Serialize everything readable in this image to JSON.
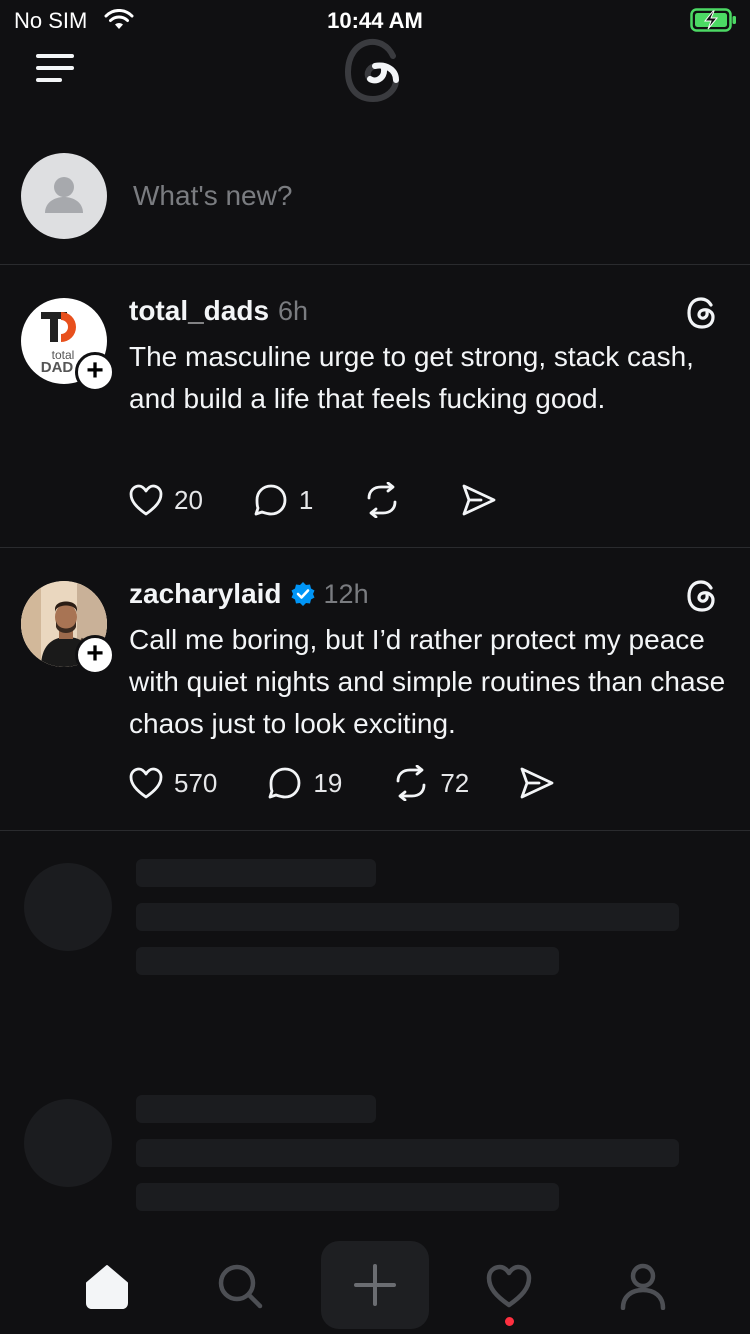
{
  "status_bar": {
    "carrier": "No SIM",
    "time": "10:44 AM",
    "battery_color": "#4cd964"
  },
  "composer": {
    "placeholder": "What's new?"
  },
  "posts": [
    {
      "username": "total_dads",
      "ago": "6h",
      "verified": false,
      "avatar_text_top": "total",
      "avatar_text_bottom": "DAD",
      "text": "The masculine urge to get strong, stack cash, and build a life that feels fucking good.",
      "likes": "20",
      "replies": "1",
      "reposts": ""
    },
    {
      "username": "zacharylaid",
      "ago": "12h",
      "verified": true,
      "text": "Call me boring, but I’d rather protect my peace with quiet nights and simple routines than chase chaos just to look exciting.",
      "likes": "570",
      "replies": "19",
      "reposts": "72"
    }
  ],
  "colors": {
    "accent_verified": "#0095f6",
    "notif_dot": "#ff3040",
    "background": "#101012"
  },
  "tab_bar": {
    "items": [
      "home-icon",
      "search-icon",
      "create-icon",
      "activity-icon",
      "profile-icon"
    ],
    "active": "home-icon"
  }
}
